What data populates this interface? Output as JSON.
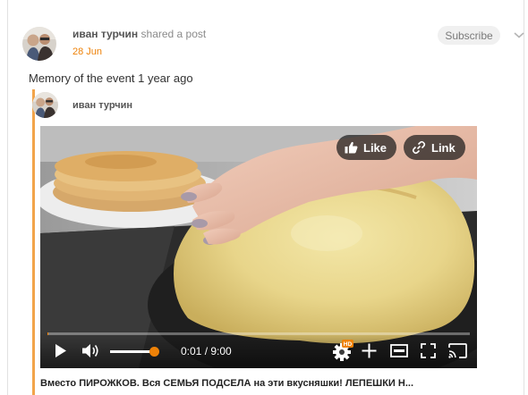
{
  "post": {
    "author_name": "иван турчин",
    "action_text": "shared a post",
    "date": "28 Jun",
    "subscribe_label": "Subscribe",
    "memory_text": "Memory of the event 1 year ago"
  },
  "reshared": {
    "author_name": "иван турчин"
  },
  "video": {
    "like_label": "Like",
    "link_label": "Link",
    "time_display": "0:01 / 9:00",
    "quality_badge": "HD",
    "progress": 0.002,
    "volume": 0.9,
    "title": "Вместо ПИРОЖКОВ. Вся СЕМЬЯ ПОДСЕЛА на эти вкусняшки! ЛЕПЕШКИ Н..."
  },
  "colors": {
    "accent": "#ee8208",
    "quote_bar": "#f2a44a",
    "subscribe_bg": "#f0f0f0"
  },
  "icons": [
    "chevron-down-icon",
    "thumbs-up-icon",
    "link-icon",
    "play-icon",
    "volume-icon",
    "settings-icon",
    "plus-icon",
    "miniplayer-icon",
    "fullscreen-icon",
    "cast-icon"
  ]
}
